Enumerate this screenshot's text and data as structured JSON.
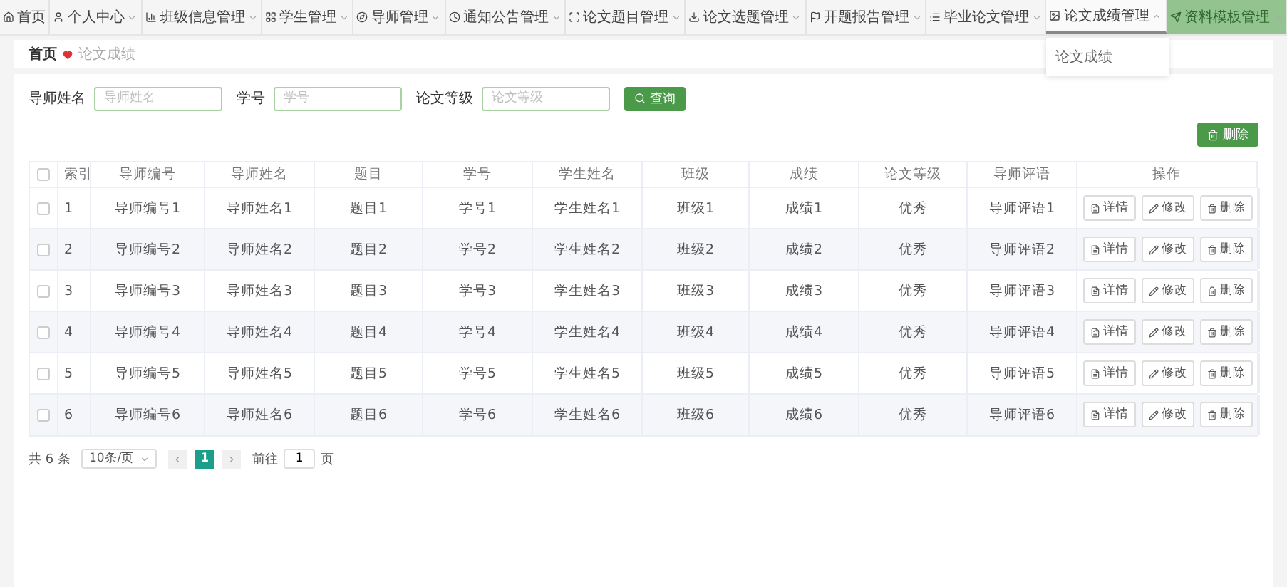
{
  "nav": [
    {
      "label": "首页",
      "dropdown": false,
      "expanded": false,
      "hovered": false
    },
    {
      "label": "个人中心",
      "dropdown": true,
      "expanded": false,
      "hovered": false
    },
    {
      "label": "班级信息管理",
      "dropdown": true,
      "expanded": false,
      "hovered": false
    },
    {
      "label": "学生管理",
      "dropdown": true,
      "expanded": false,
      "hovered": false
    },
    {
      "label": "导师管理",
      "dropdown": true,
      "expanded": false,
      "hovered": false
    },
    {
      "label": "通知公告管理",
      "dropdown": true,
      "expanded": false,
      "hovered": false
    },
    {
      "label": "论文题目管理",
      "dropdown": true,
      "expanded": false,
      "hovered": false
    },
    {
      "label": "论文选题管理",
      "dropdown": true,
      "expanded": false,
      "hovered": false
    },
    {
      "label": "开题报告管理",
      "dropdown": true,
      "expanded": false,
      "hovered": false
    },
    {
      "label": "毕业论文管理",
      "dropdown": true,
      "expanded": false,
      "hovered": false
    },
    {
      "label": "论文成绩管理",
      "dropdown": true,
      "expanded": true,
      "hovered": false,
      "menu": [
        "论文成绩"
      ]
    },
    {
      "label": "资料模板管理",
      "dropdown": true,
      "expanded": false,
      "hovered": true
    }
  ],
  "breadcrumb": [
    "首页",
    "论文成绩"
  ],
  "search": {
    "fields": [
      {
        "label": "导师姓名",
        "placeholder": "导师姓名"
      },
      {
        "label": "学号",
        "placeholder": "学号"
      },
      {
        "label": "论文等级",
        "placeholder": "论文等级"
      }
    ],
    "button": "查询"
  },
  "delete_button": "删除",
  "table": {
    "header_checked": false,
    "columns": [
      "索引",
      "导师编号",
      "导师姓名",
      "题目",
      "学号",
      "学生姓名",
      "班级",
      "成绩",
      "论文等级",
      "导师评语",
      "操作"
    ],
    "rows": [
      {
        "checked": false,
        "cells": [
          "1",
          "导师编号1",
          "导师姓名1",
          "题目1",
          "学号1",
          "学生姓名1",
          "班级1",
          "成绩1",
          "优秀",
          "导师评语1"
        ],
        "actions": [
          "详情",
          "修改",
          "删除"
        ]
      },
      {
        "checked": false,
        "cells": [
          "2",
          "导师编号2",
          "导师姓名2",
          "题目2",
          "学号2",
          "学生姓名2",
          "班级2",
          "成绩2",
          "优秀",
          "导师评语2"
        ],
        "actions": [
          "详情",
          "修改",
          "删除"
        ]
      },
      {
        "checked": false,
        "cells": [
          "3",
          "导师编号3",
          "导师姓名3",
          "题目3",
          "学号3",
          "学生姓名3",
          "班级3",
          "成绩3",
          "优秀",
          "导师评语3"
        ],
        "actions": [
          "详情",
          "修改",
          "删除"
        ]
      },
      {
        "checked": false,
        "cells": [
          "4",
          "导师编号4",
          "导师姓名4",
          "题目4",
          "学号4",
          "学生姓名4",
          "班级4",
          "成绩4",
          "优秀",
          "导师评语4"
        ],
        "actions": [
          "详情",
          "修改",
          "删除"
        ]
      },
      {
        "checked": false,
        "cells": [
          "5",
          "导师编号5",
          "导师姓名5",
          "题目5",
          "学号5",
          "学生姓名5",
          "班级5",
          "成绩5",
          "优秀",
          "导师评语5"
        ],
        "actions": [
          "详情",
          "修改",
          "删除"
        ]
      },
      {
        "checked": false,
        "cells": [
          "6",
          "导师编号6",
          "导师姓名6",
          "题目6",
          "学号6",
          "学生姓名6",
          "班级6",
          "成绩6",
          "优秀",
          "导师评语6"
        ],
        "actions": [
          "详情",
          "修改",
          "删除"
        ]
      }
    ]
  },
  "pagination": {
    "total": "共 6 条",
    "page_size": "10条/页",
    "pages": [
      {
        "label": "1",
        "selected": true
      }
    ],
    "goto_label": "前往",
    "goto_value": "1",
    "goto_suffix": "页"
  }
}
